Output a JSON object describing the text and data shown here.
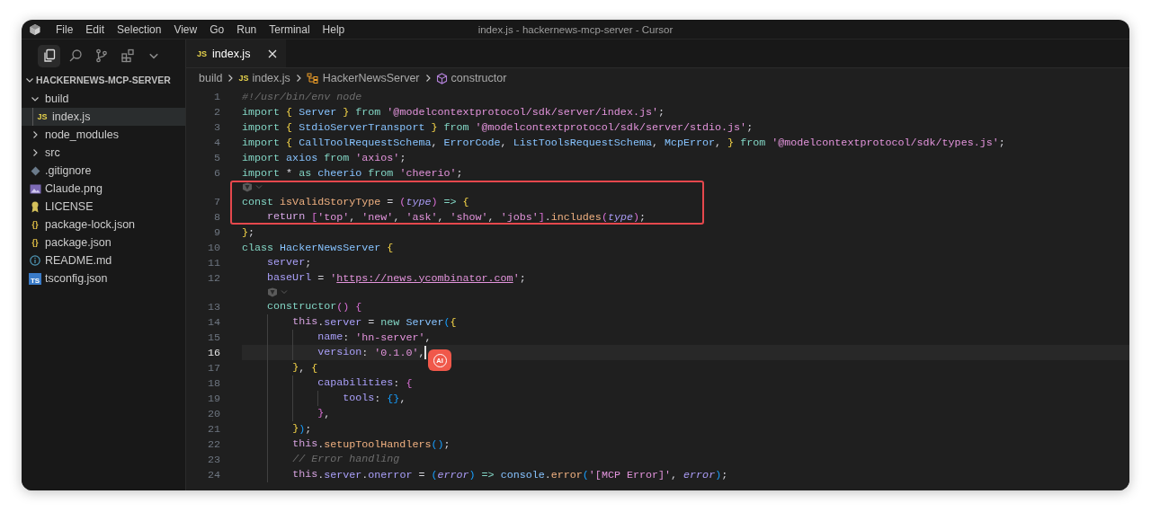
{
  "window": {
    "title": "index.js - hackernews-mcp-server - Cursor"
  },
  "menu": [
    "File",
    "Edit",
    "Selection",
    "View",
    "Go",
    "Run",
    "Terminal",
    "Help"
  ],
  "activity_bar": [
    {
      "kind": "files",
      "selected": true
    },
    {
      "kind": "search",
      "selected": false
    },
    {
      "kind": "source-control",
      "selected": false
    },
    {
      "kind": "extensions",
      "selected": false
    },
    {
      "kind": "more",
      "selected": false
    }
  ],
  "explorer": {
    "title": "HACKERNEWS-MCP-SERVER",
    "expanded": true,
    "items": [
      {
        "label": "build",
        "kind": "folder",
        "expanded": true,
        "selected": false,
        "children": [
          {
            "label": "index.js",
            "kind": "js",
            "glyph": "JS",
            "selected": true
          }
        ]
      },
      {
        "label": "node_modules",
        "kind": "folder",
        "expanded": false,
        "selected": false
      },
      {
        "label": "src",
        "kind": "folder",
        "expanded": false,
        "selected": false
      },
      {
        "label": ".gitignore",
        "kind": "git",
        "selected": false
      },
      {
        "label": "Claude.png",
        "kind": "image",
        "selected": false
      },
      {
        "label": "LICENSE",
        "kind": "license",
        "selected": false
      },
      {
        "label": "package-lock.json",
        "kind": "json",
        "glyph": "{}",
        "selected": false
      },
      {
        "label": "package.json",
        "kind": "json",
        "glyph": "{}",
        "selected": false
      },
      {
        "label": "README.md",
        "kind": "info",
        "selected": false
      },
      {
        "label": "tsconfig.json",
        "kind": "ts",
        "glyph": "TS",
        "selected": false
      }
    ]
  },
  "tabs": [
    {
      "label": "index.js",
      "glyph": "JS",
      "selected": true
    }
  ],
  "breadcrumb": [
    {
      "label": "build",
      "kind": "folder"
    },
    {
      "label": "index.js",
      "kind": "js",
      "glyph": "JS"
    },
    {
      "label": "HackerNewsServer",
      "kind": "class"
    },
    {
      "label": "constructor",
      "kind": "method"
    }
  ],
  "code": [
    {
      "kind": "line",
      "number": "1",
      "highlighted": false,
      "current": false,
      "tokens": [
        {
          "kind": "c",
          "text": "#!/usr/bin/env node"
        }
      ]
    },
    {
      "kind": "line",
      "number": "2",
      "highlighted": false,
      "current": false,
      "tokens": [
        {
          "kind": "k",
          "text": "import "
        },
        {
          "kind": "b",
          "text": "{ "
        },
        {
          "kind": "v",
          "text": "Server "
        },
        {
          "kind": "b",
          "text": "} "
        },
        {
          "kind": "k",
          "text": "from "
        },
        {
          "kind": "s",
          "text": "'@modelcontextprotocol/sdk/server/index.js'"
        },
        {
          "kind": "o",
          "text": ";"
        }
      ]
    },
    {
      "kind": "line",
      "number": "3",
      "highlighted": false,
      "current": false,
      "tokens": [
        {
          "kind": "k",
          "text": "import "
        },
        {
          "kind": "b",
          "text": "{ "
        },
        {
          "kind": "v",
          "text": "StdioServerTransport "
        },
        {
          "kind": "b",
          "text": "} "
        },
        {
          "kind": "k",
          "text": "from "
        },
        {
          "kind": "s",
          "text": "'@modelcontextprotocol/sdk/server/stdio.js'"
        },
        {
          "kind": "o",
          "text": ";"
        }
      ]
    },
    {
      "kind": "line",
      "number": "4",
      "highlighted": false,
      "current": false,
      "tokens": [
        {
          "kind": "k",
          "text": "import "
        },
        {
          "kind": "b",
          "text": "{ "
        },
        {
          "kind": "v",
          "text": "CallToolRequestSchema"
        },
        {
          "kind": "o",
          "text": ", "
        },
        {
          "kind": "v",
          "text": "ErrorCode"
        },
        {
          "kind": "o",
          "text": ", "
        },
        {
          "kind": "v",
          "text": "ListToolsRequestSchema"
        },
        {
          "kind": "o",
          "text": ", "
        },
        {
          "kind": "v",
          "text": "McpError"
        },
        {
          "kind": "o",
          "text": ", "
        },
        {
          "kind": "b",
          "text": "} "
        },
        {
          "kind": "k",
          "text": "from "
        },
        {
          "kind": "s",
          "text": "'@modelcontextprotocol/sdk/types.js'"
        },
        {
          "kind": "o",
          "text": ";"
        }
      ]
    },
    {
      "kind": "line",
      "number": "5",
      "highlighted": false,
      "current": false,
      "tokens": [
        {
          "kind": "k",
          "text": "import "
        },
        {
          "kind": "v",
          "text": "axios "
        },
        {
          "kind": "k",
          "text": "from "
        },
        {
          "kind": "s",
          "text": "'axios'"
        },
        {
          "kind": "o",
          "text": ";"
        }
      ]
    },
    {
      "kind": "line",
      "number": "6",
      "highlighted": false,
      "current": false,
      "tokens": [
        {
          "kind": "k",
          "text": "import "
        },
        {
          "kind": "o",
          "text": "* "
        },
        {
          "kind": "k",
          "text": "as "
        },
        {
          "kind": "v",
          "text": "cheerio "
        },
        {
          "kind": "k",
          "text": "from "
        },
        {
          "kind": "s",
          "text": "'cheerio'"
        },
        {
          "kind": "o",
          "text": ";"
        }
      ]
    },
    {
      "kind": "lens",
      "highlighted": true,
      "indented": false
    },
    {
      "kind": "line",
      "number": "7",
      "highlighted": true,
      "current": false,
      "tokens": [
        {
          "kind": "k",
          "text": "const "
        },
        {
          "kind": "f",
          "text": "isValidStoryType"
        },
        {
          "kind": "o",
          "text": " = "
        },
        {
          "kind": "b2",
          "text": "("
        },
        {
          "kind": "p",
          "text": "type"
        },
        {
          "kind": "b2",
          "text": ")"
        },
        {
          "kind": "k",
          "text": " => "
        },
        {
          "kind": "b",
          "text": "{"
        }
      ]
    },
    {
      "kind": "line",
      "number": "8",
      "highlighted": true,
      "current": false,
      "tokens": [
        {
          "kind": "r",
          "text": "    return "
        },
        {
          "kind": "b2",
          "text": "["
        },
        {
          "kind": "s",
          "text": "'top'"
        },
        {
          "kind": "o",
          "text": ", "
        },
        {
          "kind": "s",
          "text": "'new'"
        },
        {
          "kind": "o",
          "text": ", "
        },
        {
          "kind": "s",
          "text": "'ask'"
        },
        {
          "kind": "o",
          "text": ", "
        },
        {
          "kind": "s",
          "text": "'show'"
        },
        {
          "kind": "o",
          "text": ", "
        },
        {
          "kind": "s",
          "text": "'jobs'"
        },
        {
          "kind": "b2",
          "text": "]"
        },
        {
          "kind": "o",
          "text": "."
        },
        {
          "kind": "f",
          "text": "includes"
        },
        {
          "kind": "b2",
          "text": "("
        },
        {
          "kind": "p",
          "text": "type"
        },
        {
          "kind": "b2",
          "text": ")"
        },
        {
          "kind": "o",
          "text": ";"
        }
      ]
    },
    {
      "kind": "line",
      "number": "9",
      "highlighted": false,
      "current": false,
      "tokens": [
        {
          "kind": "b",
          "text": "}"
        },
        {
          "kind": "o",
          "text": ";"
        }
      ]
    },
    {
      "kind": "line",
      "number": "10",
      "highlighted": false,
      "current": false,
      "tokens": [
        {
          "kind": "k",
          "text": "class "
        },
        {
          "kind": "v",
          "text": "HackerNewsServer "
        },
        {
          "kind": "b",
          "text": "{"
        }
      ]
    },
    {
      "kind": "line",
      "number": "11",
      "highlighted": false,
      "current": false,
      "tokens": [
        {
          "kind": "pr",
          "text": "    server"
        },
        {
          "kind": "o",
          "text": ";"
        }
      ]
    },
    {
      "kind": "line",
      "number": "12",
      "highlighted": false,
      "current": false,
      "tokens": [
        {
          "kind": "pr",
          "text": "    baseUrl"
        },
        {
          "kind": "o",
          "text": " = "
        },
        {
          "kind": "s",
          "text": "'"
        },
        {
          "kind": "u",
          "text": "https://news.ycombinator.com"
        },
        {
          "kind": "s",
          "text": "'"
        },
        {
          "kind": "o",
          "text": ";"
        }
      ]
    },
    {
      "kind": "lens",
      "highlighted": false,
      "indented": true
    },
    {
      "kind": "line",
      "number": "13",
      "highlighted": false,
      "current": false,
      "tokens": [
        {
          "kind": "k",
          "text": "    constructor"
        },
        {
          "kind": "b2",
          "text": "() {"
        }
      ]
    },
    {
      "kind": "line",
      "number": "14",
      "highlighted": false,
      "current": false,
      "tokens": [
        {
          "kind": "t",
          "text": "        this"
        },
        {
          "kind": "o",
          "text": "."
        },
        {
          "kind": "pr",
          "text": "server"
        },
        {
          "kind": "o",
          "text": " = "
        },
        {
          "kind": "k",
          "text": "new "
        },
        {
          "kind": "v",
          "text": "Server"
        },
        {
          "kind": "b3",
          "text": "("
        },
        {
          "kind": "b",
          "text": "{"
        }
      ]
    },
    {
      "kind": "line",
      "number": "15",
      "highlighted": false,
      "current": false,
      "tokens": [
        {
          "kind": "pr",
          "text": "            name"
        },
        {
          "kind": "o",
          "text": ": "
        },
        {
          "kind": "s",
          "text": "'hn-server'"
        },
        {
          "kind": "o",
          "text": ","
        }
      ]
    },
    {
      "kind": "line",
      "number": "16",
      "highlighted": false,
      "current": true,
      "tokens": [
        {
          "kind": "pr",
          "text": "            version"
        },
        {
          "kind": "o",
          "text": ": "
        },
        {
          "kind": "s",
          "text": "'0.1.0'"
        },
        {
          "kind": "o",
          "text": ","
        }
      ]
    },
    {
      "kind": "line",
      "number": "17",
      "highlighted": false,
      "current": false,
      "tokens": [
        {
          "kind": "b",
          "text": "        }"
        },
        {
          "kind": "o",
          "text": ", "
        },
        {
          "kind": "b",
          "text": "{"
        }
      ]
    },
    {
      "kind": "line",
      "number": "18",
      "highlighted": false,
      "current": false,
      "tokens": [
        {
          "kind": "pr",
          "text": "            capabilities"
        },
        {
          "kind": "o",
          "text": ": "
        },
        {
          "kind": "b2",
          "text": "{"
        }
      ]
    },
    {
      "kind": "line",
      "number": "19",
      "highlighted": false,
      "current": false,
      "tokens": [
        {
          "kind": "pr",
          "text": "                tools"
        },
        {
          "kind": "o",
          "text": ": "
        },
        {
          "kind": "b3",
          "text": "{}"
        },
        {
          "kind": "o",
          "text": ","
        }
      ]
    },
    {
      "kind": "line",
      "number": "20",
      "highlighted": false,
      "current": false,
      "tokens": [
        {
          "kind": "b2",
          "text": "            }"
        },
        {
          "kind": "o",
          "text": ","
        }
      ]
    },
    {
      "kind": "line",
      "number": "21",
      "highlighted": false,
      "current": false,
      "tokens": [
        {
          "kind": "b",
          "text": "        }"
        },
        {
          "kind": "b3",
          "text": ")"
        },
        {
          "kind": "o",
          "text": ";"
        }
      ]
    },
    {
      "kind": "line",
      "number": "22",
      "highlighted": false,
      "current": false,
      "tokens": [
        {
          "kind": "t",
          "text": "        this"
        },
        {
          "kind": "o",
          "text": "."
        },
        {
          "kind": "f",
          "text": "setupToolHandlers"
        },
        {
          "kind": "b3",
          "text": "()"
        },
        {
          "kind": "o",
          "text": ";"
        }
      ]
    },
    {
      "kind": "line",
      "number": "23",
      "highlighted": false,
      "current": false,
      "tokens": [
        {
          "kind": "c",
          "text": "        // Error handling"
        }
      ]
    },
    {
      "kind": "line",
      "number": "24",
      "highlighted": false,
      "current": false,
      "tokens": [
        {
          "kind": "t",
          "text": "        this"
        },
        {
          "kind": "o",
          "text": "."
        },
        {
          "kind": "pr",
          "text": "server"
        },
        {
          "kind": "o",
          "text": "."
        },
        {
          "kind": "pr",
          "text": "onerror"
        },
        {
          "kind": "o",
          "text": " = "
        },
        {
          "kind": "b3",
          "text": "("
        },
        {
          "kind": "p",
          "text": "error"
        },
        {
          "kind": "b3",
          "text": ")"
        },
        {
          "kind": "k",
          "text": " => "
        },
        {
          "kind": "v",
          "text": "console"
        },
        {
          "kind": "o",
          "text": "."
        },
        {
          "kind": "f",
          "text": "error"
        },
        {
          "kind": "b3",
          "text": "("
        },
        {
          "kind": "s",
          "text": "'[MCP Error]'"
        },
        {
          "kind": "o",
          "text": ", "
        },
        {
          "kind": "p",
          "text": "error"
        },
        {
          "kind": "b3",
          "text": ")"
        },
        {
          "kind": "o",
          "text": ";"
        }
      ]
    }
  ],
  "ai_badge": {
    "label": "AI"
  }
}
